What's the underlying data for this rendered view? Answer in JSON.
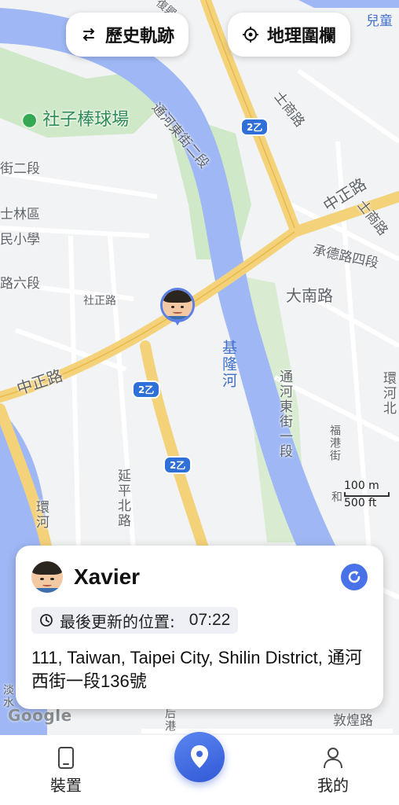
{
  "top_bar": {
    "history_label": "歷史軌跡",
    "geofence_label": "地理圍欄"
  },
  "map": {
    "labels": {
      "park": "社子棒球場",
      "river": "基隆河",
      "tonghe_east_2": "通河東街二段",
      "tonghe_east_1": "通河東街一段",
      "zhongzheng_rd_left": "中正路",
      "zhongzheng_rd_right": "中正路",
      "shezheng_rd": "社正路",
      "yanping_n_rd": "延平北路",
      "chengde_rd_4": "承德路四段",
      "danan_rd": "大南路",
      "shinan_rd": "士商路",
      "shishang_rd": "士商路",
      "shilin_district": "士林區",
      "elementary_school": "民小學",
      "street_2": "街二段",
      "road_6": "路六段",
      "huanhe_rd": "環河",
      "fuxing_rd": "福港街",
      "jihua": "和",
      "jihe": "環河北",
      "dunhuang": "敦煌路",
      "bottom_left": "淡水",
      "bottom_mid": "后港",
      "top_right_place": "兒童",
      "top_left_road": "復興"
    },
    "route_shields": [
      "2乙",
      "2乙",
      "2乙"
    ],
    "scale": {
      "metric": "100 m",
      "imperial": "500 ft"
    },
    "attribution": "Google",
    "tracked_person_avatar": "avatar-xavier"
  },
  "info_card": {
    "name": "Xavier",
    "last_update_label": "最後更新的位置:",
    "last_update_time": "07:22",
    "address": "111, Taiwan, Taipei City, Shilin District, 通河西街一段136號"
  },
  "bottom_nav": {
    "device_label": "裝置",
    "profile_label": "我的"
  },
  "colors": {
    "river": "#9fb8f5",
    "highway": "#f4d27a",
    "park": "#cfe8c8",
    "accent": "#4a72e8"
  }
}
